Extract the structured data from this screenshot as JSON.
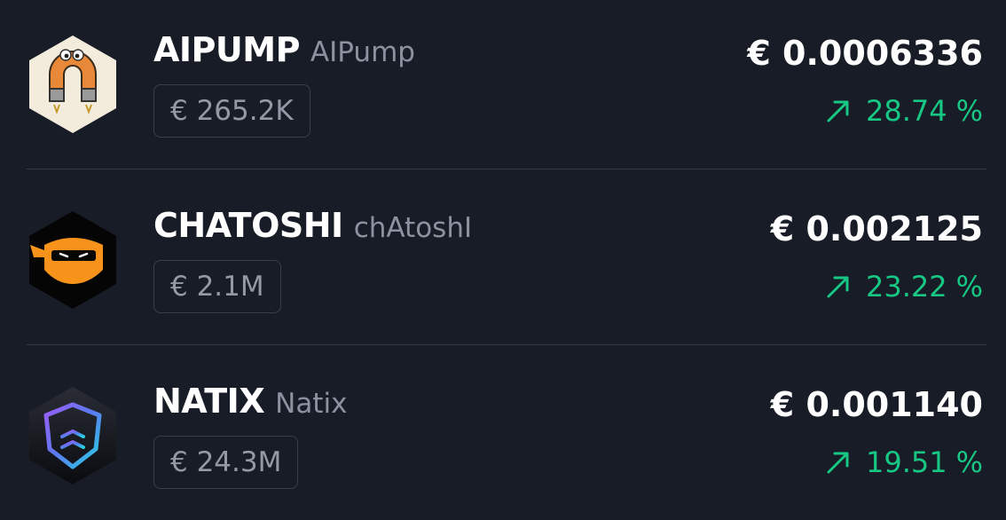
{
  "tokens": [
    {
      "symbol": "AIPUMP",
      "name": "AIPump",
      "market_cap": "€ 265.2K",
      "price": "€ 0.0006336",
      "change": "28.74",
      "change_unit": "%",
      "icon": "magnet-mascot-icon",
      "trend": "up"
    },
    {
      "symbol": "CHATOSHI",
      "name": "chAtoshI",
      "market_cap": "€ 2.1M",
      "price": "€ 0.002125",
      "change": "23.22",
      "change_unit": "%",
      "icon": "ninja-mask-icon",
      "trend": "up"
    },
    {
      "symbol": "NATIX",
      "name": "Natix",
      "market_cap": "€ 24.3M",
      "price": "€ 0.001140",
      "change": "19.51",
      "change_unit": "%",
      "icon": "natix-shield-icon",
      "trend": "up"
    }
  ],
  "colors": {
    "background": "#181c27",
    "positive": "#17c784",
    "muted_text": "#8e92a0",
    "divider": "#343846"
  }
}
